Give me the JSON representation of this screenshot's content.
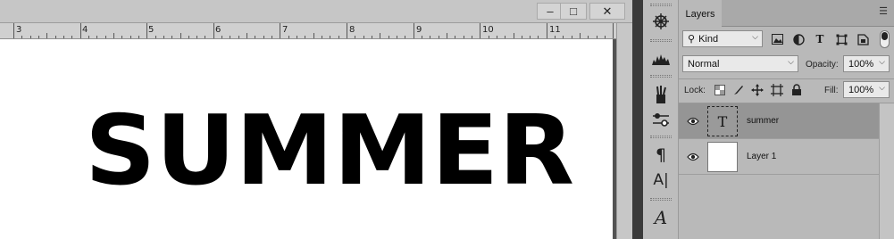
{
  "document": {
    "window_controls": {
      "minimize": "‒",
      "restore": "□",
      "close": "✕"
    },
    "ruler_numbers": [
      "3",
      "4",
      "5",
      "6",
      "7",
      "8",
      "9",
      "10",
      "11"
    ],
    "canvas_text": "SUMMER"
  },
  "toolstrip": {
    "tools": [
      "navigator-icon",
      "histogram-icon",
      "brush-presets-icon",
      "adjustments-icon",
      "paragraph-icon",
      "character-icon",
      "glyphs-icon"
    ],
    "paragraph_glyph": "¶",
    "character_glyph": "A|",
    "glyphs_glyph": "A"
  },
  "layers": {
    "tab_label": "Layers",
    "filter": {
      "kind_label": "Kind"
    },
    "blend_mode": "Normal",
    "opacity_label": "Opacity:",
    "opacity_value": "100%",
    "lock_label": "Lock:",
    "fill_label": "Fill:",
    "fill_value": "100%",
    "items": [
      {
        "name": "summer",
        "type": "text",
        "thumb_glyph": "T",
        "selected": true,
        "visible": true
      },
      {
        "name": "Layer 1",
        "type": "pixel",
        "selected": false,
        "visible": true
      }
    ]
  },
  "colors": {
    "panel_bg": "#b9b9b9",
    "selected_layer": "#959595",
    "canvas": "#ffffff",
    "workspace": "#535353"
  }
}
